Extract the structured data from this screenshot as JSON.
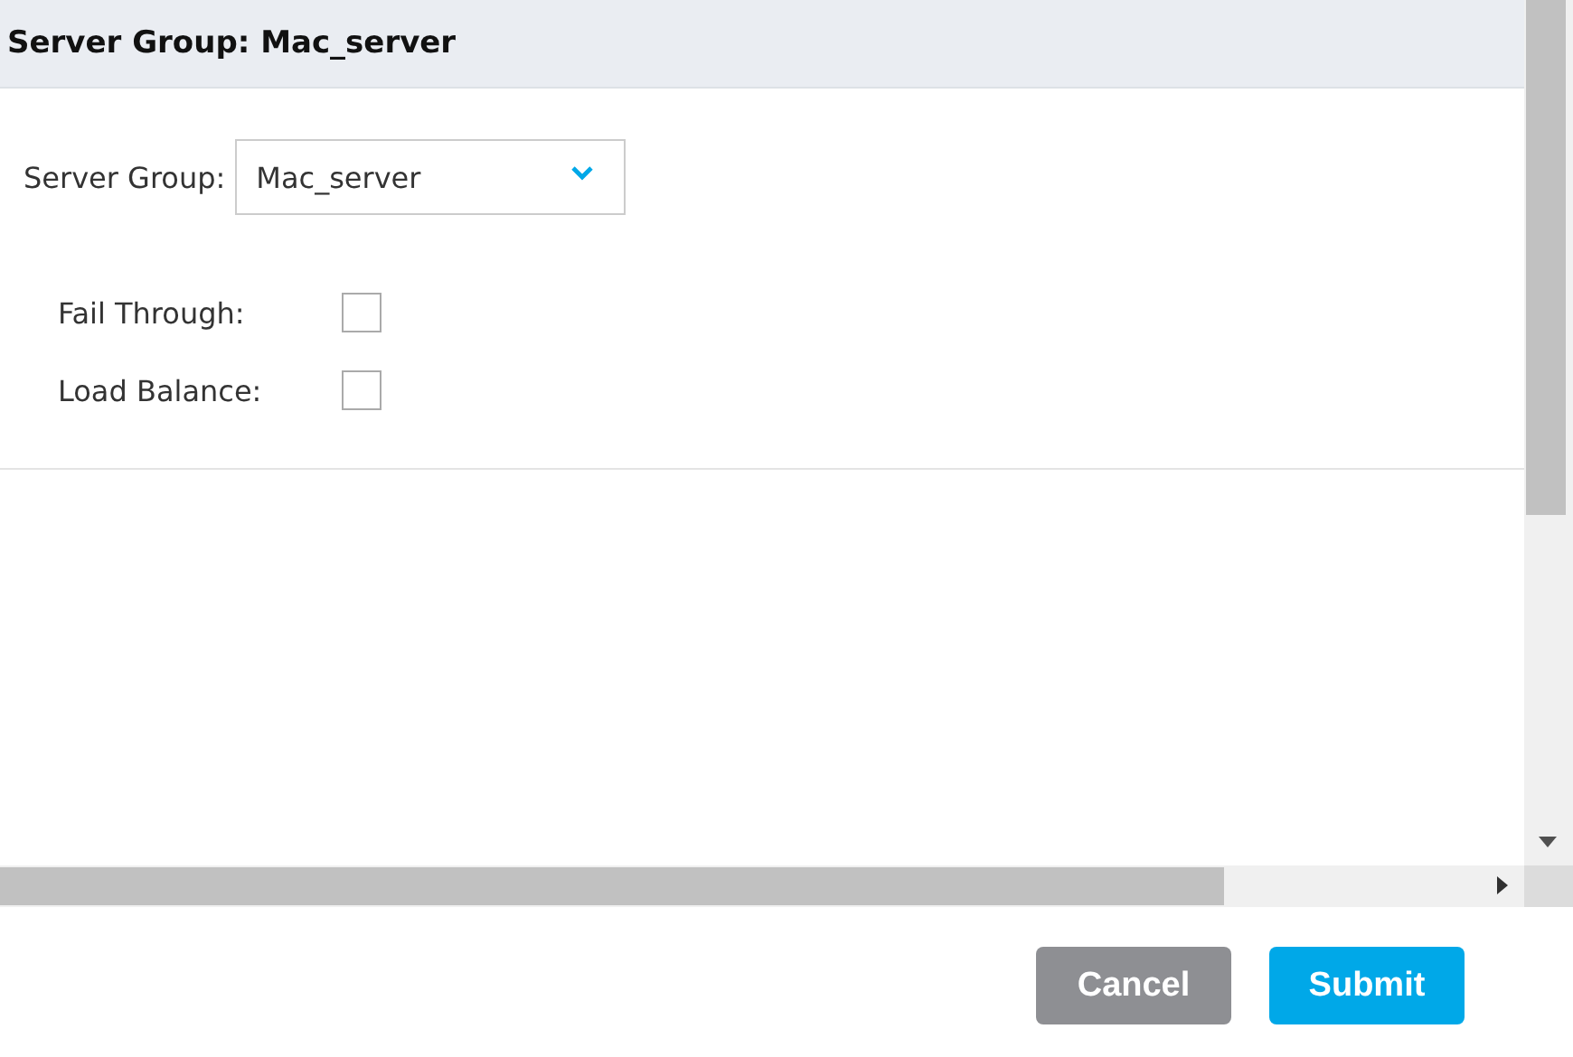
{
  "header": {
    "title": "Server Group: Mac_server"
  },
  "server_group": {
    "label": "Server Group:",
    "value": "Mac_server"
  },
  "options": [
    {
      "label": "Fail Through:",
      "checked": false
    },
    {
      "label": "Load Balance:",
      "checked": false
    }
  ],
  "buttons": [
    {
      "label": "Cancel",
      "kind": "secondary"
    },
    {
      "label": "Submit",
      "kind": "primary"
    }
  ]
}
